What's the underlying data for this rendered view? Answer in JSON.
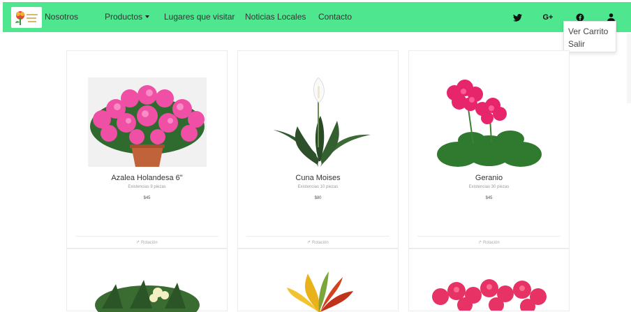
{
  "navbar": {
    "bg_color": "#4ee68e",
    "logo_text": "Villa Floral",
    "links": [
      "Nosotros",
      "Productos",
      "Lugares que visitar",
      "Noticias Locales",
      "Contacto"
    ],
    "icons": [
      "twitter-icon",
      "google-plus-icon",
      "facebook-icon",
      "user-icon"
    ],
    "gplus_label": "G+"
  },
  "dropdown": {
    "items": [
      "Ver Carrito",
      "Salir"
    ]
  },
  "products": [
    {
      "name": "Azalea Holandesa 6\"",
      "stock": "Existencias 9 piezas",
      "price": "$45",
      "action": "Rotación"
    },
    {
      "name": "Cuna Moises",
      "stock": "Existencias 10 piezas",
      "price": "$80",
      "action": "Rotación"
    },
    {
      "name": "Geranio",
      "stock": "Existencias 30 piezas",
      "price": "$45",
      "action": "Rotación"
    }
  ]
}
